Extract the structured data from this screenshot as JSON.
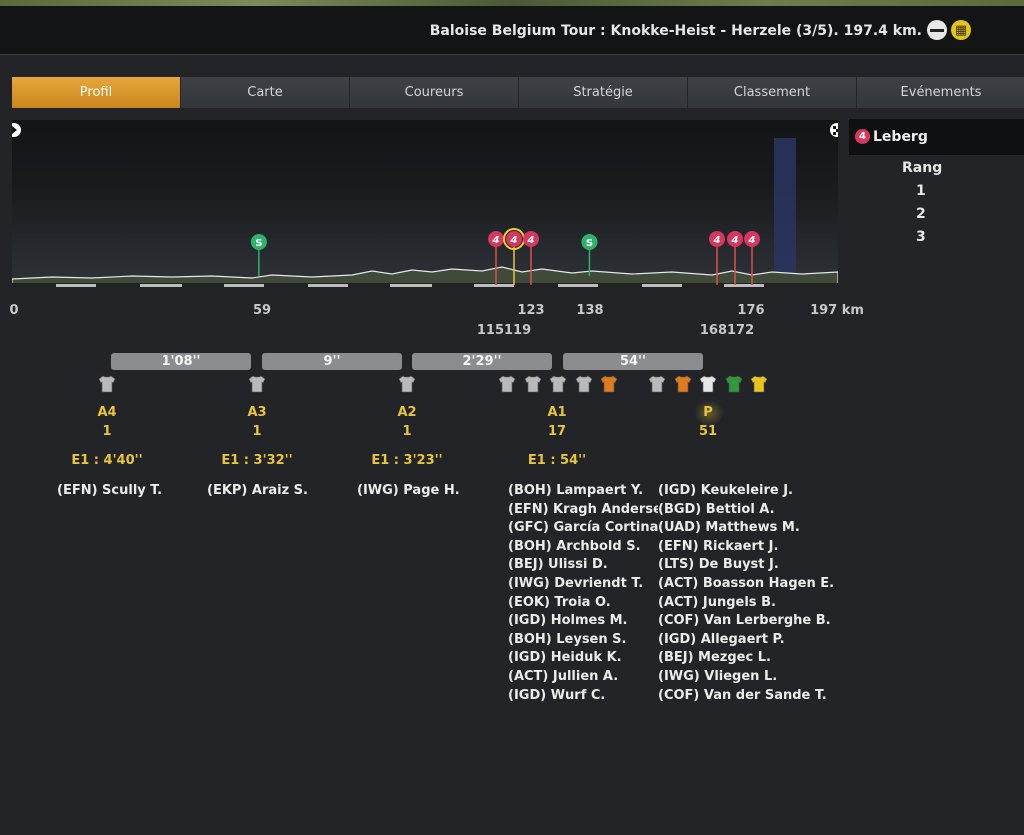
{
  "header": {
    "race_title": "Baloise Belgium Tour : Knokke-Heist - Herzele (3/5). 197.4 km.",
    "icons": [
      "flat-stage-icon",
      "cobbles-icon"
    ]
  },
  "tabs": [
    {
      "label": "Profil",
      "active": true
    },
    {
      "label": "Carte",
      "active": false
    },
    {
      "label": "Coureurs",
      "active": false
    },
    {
      "label": "Stratégie",
      "active": false
    },
    {
      "label": "Classement",
      "active": false
    },
    {
      "label": "Evénements",
      "active": false
    }
  ],
  "profile": {
    "total_km": 197.4,
    "km_labels": {
      "start": "0",
      "sprint1": "59",
      "climb2": "123",
      "sprint2": "138",
      "climb5": "176",
      "finish": "197 km"
    },
    "km_labels_row2": {
      "climb1_3": "115119",
      "climb4": "168172"
    },
    "sprints": [
      {
        "label": "S",
        "km": 59
      },
      {
        "label": "S",
        "km": 138
      }
    ],
    "climbs": [
      {
        "label": "4",
        "km": 115
      },
      {
        "label": "4",
        "km": 119,
        "selected": true
      },
      {
        "label": "4",
        "km": 123
      },
      {
        "label": "4",
        "km": 168
      },
      {
        "label": "4",
        "km": 172
      },
      {
        "label": "4",
        "km": 176
      }
    ],
    "colors": {
      "sprint": "#2fb36a",
      "climb": "#d7365e",
      "accent": "#e7a73c"
    }
  },
  "side_panel": {
    "climb_badge": "4",
    "climb_name": "Leberg",
    "rang_title": "Rang",
    "ranks": [
      "1",
      "2",
      "3"
    ]
  },
  "gap_bars": [
    "1'08''",
    "9''",
    "2'29''",
    "54''"
  ],
  "groups": [
    {
      "code": "A4",
      "count": "1",
      "gap": "E1 : 4'40''"
    },
    {
      "code": "A3",
      "count": "1",
      "gap": "E1 : 3'32''"
    },
    {
      "code": "A2",
      "count": "1",
      "gap": "E1 : 3'23''"
    },
    {
      "code": "A1",
      "count": "17",
      "gap": "E1 : 54''"
    },
    {
      "code": "P",
      "count": "51"
    }
  ],
  "jerseys": {
    "A4": [
      "white"
    ],
    "A3": [
      "white"
    ],
    "A2": [
      "white"
    ],
    "A1": [
      "white",
      "white",
      "white",
      "white",
      "orange"
    ],
    "P": [
      "white",
      "orange",
      "light",
      "green",
      "yellow"
    ]
  },
  "riders": {
    "A4": [
      "(EFN) Scully T."
    ],
    "A3": [
      "(EKP) Araiz S."
    ],
    "A2": [
      "(IWG) Page H."
    ],
    "A1_col1": [
      "(BOH) Lampaert Y.",
      "(EFN) Kragh Andersen S.",
      "(GFC) García Cortina I.",
      "(BOH) Archbold S.",
      "(BEJ) Ulissi D.",
      "(IWG) Devriendt T.",
      "(EOK) Troia O.",
      "(IGD) Holmes M.",
      "(BOH) Leysen S.",
      "(IGD) Heiduk K.",
      "(ACT) Jullien A.",
      "(IGD) Wurf C."
    ],
    "A1_col2": [
      "(IGD) Keukeleire J.",
      "(BGD) Bettiol A.",
      "(UAD) Matthews M.",
      "(EFN) Rickaert J.",
      "(LTS) De Buyst J.",
      "(ACT) Boasson Hagen E.",
      "(ACT) Jungels B.",
      "(COF) Van Lerberghe B.",
      "(IGD) Allegaert P.",
      "(BEJ) Mezgec L.",
      "(IWG) Vliegen L.",
      "(COF) Van der Sande T."
    ]
  }
}
